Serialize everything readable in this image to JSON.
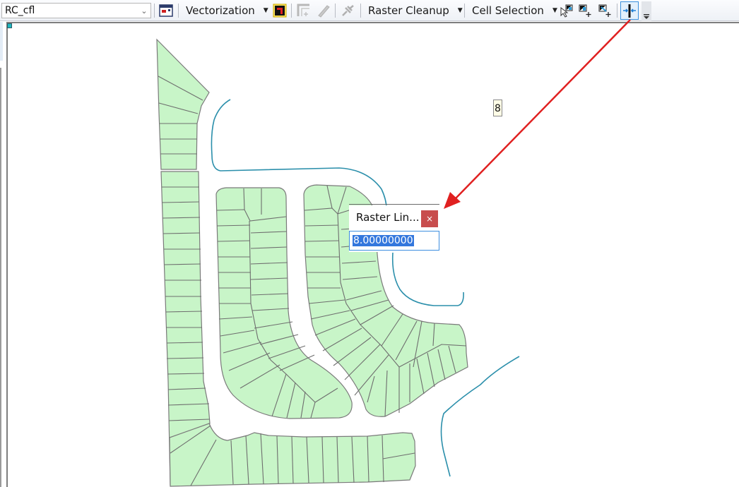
{
  "toolbar": {
    "layer_combo": {
      "value": "RC_cfl"
    },
    "menus": [
      {
        "label": "Vectorization"
      },
      {
        "label": "Raster Cleanup"
      },
      {
        "label": "Cell Selection"
      }
    ],
    "icons": [
      "vectorization-window-icon",
      "generate-features-icon",
      "raster-snapping-icon",
      "raster-painter-icon",
      "raster-trace-icon",
      "select-connected-cells-icon",
      "interactive-selection-add-icon",
      "select-cells-add-icon",
      "raster-line-width-icon",
      "toolbar-overflow-icon"
    ]
  },
  "map": {
    "cell_label": "8",
    "parcel_fill": "#c8f5c8",
    "road_color": "#2b8fab"
  },
  "dialog": {
    "title": "Raster Lin...",
    "close_label": "×",
    "value": "8.00000000"
  },
  "annotation": {
    "arrow_color": "#e02020"
  }
}
